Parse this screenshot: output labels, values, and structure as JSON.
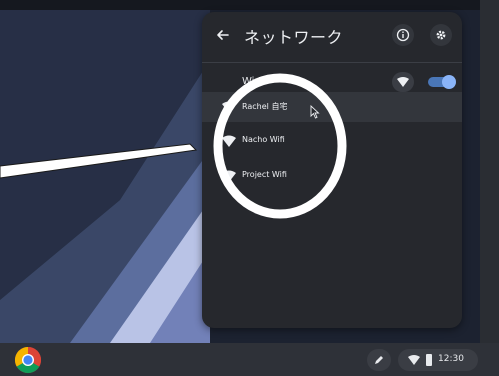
{
  "panel": {
    "title": "ネットワーク",
    "wifi_label": "Wi-Fi",
    "wifi_enabled": true,
    "networks": [
      {
        "name": "Rachel 自宅",
        "hovered": true
      },
      {
        "name": "Nacho Wifi",
        "hovered": false
      },
      {
        "name": "Project Wifi",
        "hovered": false
      }
    ]
  },
  "shelf": {
    "time": "12:30"
  },
  "icons": {
    "back": "back-arrow-icon",
    "info": "info-icon",
    "settings": "gear-icon",
    "wifi": "wifi-icon",
    "launcher": "chrome-icon",
    "pen": "stylus-icon",
    "battery": "battery-icon"
  },
  "colors": {
    "panel_bg": "#26282d",
    "accent": "#8ab4f8",
    "annotation": "#ffffff"
  }
}
